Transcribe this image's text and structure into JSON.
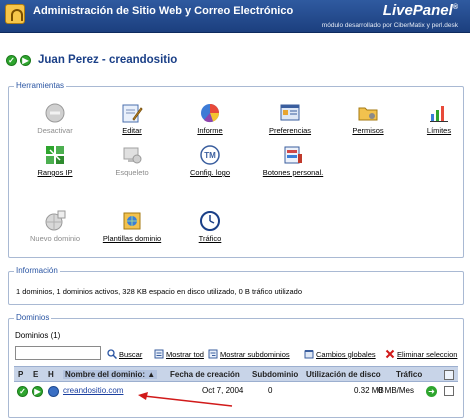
{
  "header": {
    "title": "Administración de Sitio Web y Correo Electrónico",
    "brand": "LivePanel",
    "brand_mark": "®",
    "tagline": "módulo desarrollado por CiberMatix y perl.desk"
  },
  "user": {
    "name": "Juan Perez - creandositio",
    "icons": [
      "check-icon",
      "play-icon"
    ]
  },
  "herramientas": {
    "legend": "Herramientas",
    "tools": [
      {
        "label": "Desactivar",
        "icon": "disable-icon",
        "enabled": false
      },
      {
        "label": "Editar",
        "icon": "edit-icon",
        "enabled": true
      },
      {
        "label": "Informe",
        "icon": "pie-chart-icon",
        "enabled": true
      },
      {
        "label": "Preferencias",
        "icon": "preferences-icon",
        "enabled": true
      },
      {
        "label": "Permisos",
        "icon": "folder-icon",
        "enabled": true
      },
      {
        "label": "Límites",
        "icon": "limits-icon",
        "enabled": true
      },
      {
        "label": "Rangos IP",
        "icon": "network-icon",
        "enabled": true
      },
      {
        "label": "Esqueleto",
        "icon": "skeleton-icon",
        "enabled": false
      },
      {
        "label": "Config. logo",
        "icon": "logo-icon",
        "enabled": true
      },
      {
        "label": "Botones personal.",
        "icon": "buttons-icon",
        "enabled": true
      },
      {
        "label": "Nuevo dominio",
        "icon": "new-domain-icon",
        "enabled": false
      },
      {
        "label": "Plantillas dominio",
        "icon": "templates-icon",
        "enabled": true
      },
      {
        "label": "Tráfico",
        "icon": "traffic-icon",
        "enabled": true
      }
    ]
  },
  "informacion": {
    "legend": "Información",
    "text": "1 dominios, 1 dominios activos, 328 KB espacio en disco utilizado, 0 B tráfico utilizado"
  },
  "dominios": {
    "legend": "Dominios",
    "count": "Dominios (1)",
    "search_value": "",
    "actions": [
      {
        "label": "Buscar",
        "icon": "search-icon"
      },
      {
        "label": "Mostrar tod",
        "icon": "show-all-icon"
      },
      {
        "label": "Mostrar subdominios",
        "icon": "show-subdomains-icon"
      },
      {
        "label": "Cambios globales",
        "icon": "global-changes-icon"
      },
      {
        "label": "Eliminar seleccion",
        "icon": "delete-icon"
      }
    ],
    "columns": {
      "p": "P",
      "e": "E",
      "h": "H",
      "name": "Nombre del dominio: ▲",
      "created": "Fecha de creación",
      "subdomain": "Subdominio",
      "disk": "Utilización de disco",
      "traffic": "Tráfico"
    },
    "rows": [
      {
        "name": "creandositio.com",
        "created": "Oct 7, 2004",
        "subdomain": "0",
        "disk": "0.32 MB",
        "traffic": "0 MB/Mes"
      }
    ]
  },
  "colors": {
    "header_bg": "#1c3f7e",
    "accent": "#2a55a3",
    "table_header": "#c8d4e8",
    "annotation_arrow": "#d11a1a"
  }
}
